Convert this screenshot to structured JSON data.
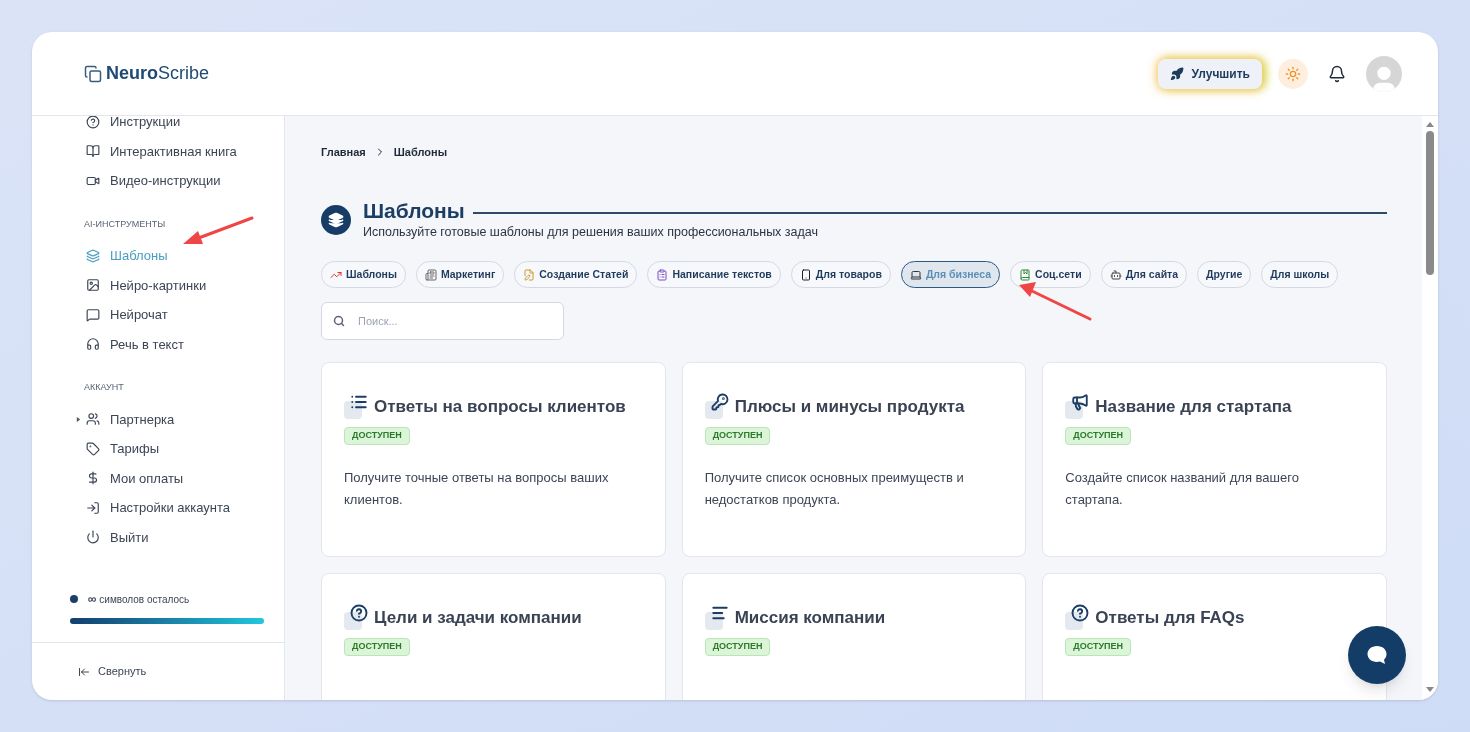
{
  "header": {
    "logo_bold": "Neuro",
    "logo_light": "Scribe",
    "upgrade_button": "Улучшить"
  },
  "sidebar": {
    "sections": [
      {
        "items": [
          {
            "label": "Инструкции",
            "selected": false
          },
          {
            "label": "Интерактивная книга",
            "selected": false
          },
          {
            "label": "Видео-инструкции",
            "selected": false
          }
        ]
      },
      {
        "heading": "AI-ИНСТРУМЕНТЫ",
        "items": [
          {
            "label": "Шаблоны",
            "selected": true
          },
          {
            "label": "Нейро-картинки",
            "selected": false
          },
          {
            "label": "Нейрочат",
            "selected": false
          },
          {
            "label": "Речь в текст",
            "selected": false
          }
        ]
      },
      {
        "heading": "АККАУНТ",
        "items": [
          {
            "label": "Партнерка",
            "selected": false,
            "expanded": false
          },
          {
            "label": "Тарифы",
            "selected": false
          },
          {
            "label": "Мои оплаты",
            "selected": false
          },
          {
            "label": "Настройки аккаунта",
            "selected": false
          },
          {
            "label": "Выйти",
            "selected": false
          }
        ]
      }
    ],
    "usage": {
      "count": "∞",
      "label": "символов осталось",
      "level": 1
    },
    "collapse_button": "Свернуть"
  },
  "main": {
    "breadcrumb": [
      "Главная",
      "Шаблоны"
    ],
    "title": "Шаблоны",
    "subtitle": "Используйте готовые шаблоны для решения ваших профессиональных задач",
    "chips": [
      {
        "label": "Шаблоны",
        "selected": false
      },
      {
        "label": "Маркетинг",
        "selected": false
      },
      {
        "label": "Создание Статей",
        "selected": false
      },
      {
        "label": "Написание текстов",
        "selected": false
      },
      {
        "label": "Для товаров",
        "selected": false
      },
      {
        "label": "Для бизнеса",
        "selected": true
      },
      {
        "label": "Соц.сети",
        "selected": false
      },
      {
        "label": "Для сайта",
        "selected": false
      },
      {
        "label": "Другие",
        "selected": false
      },
      {
        "label": "Для школы",
        "selected": false
      }
    ],
    "search": {
      "placeholder": "Поиск..."
    },
    "cards": [
      {
        "title": "Ответы на вопросы клиентов",
        "badge": "ДОСТУПЕН",
        "description": "Получите точные ответы на вопросы ваших клиентов."
      },
      {
        "title": "Плюсы и минусы продукта",
        "badge": "ДОСТУПЕН",
        "description": "Получите список основных преимуществ и недостатков продукта."
      },
      {
        "title": "Название для стартапа",
        "badge": "ДОСТУПЕН",
        "description": "Создайте список названий для вашего стартапа."
      },
      {
        "title": "Цели и задачи компании",
        "badge": "ДОСТУПЕН"
      },
      {
        "title": "Миссия компании",
        "badge": "ДОСТУПЕН"
      },
      {
        "title": "Ответы для FAQs",
        "badge": "ДОСТУПЕН"
      }
    ]
  }
}
